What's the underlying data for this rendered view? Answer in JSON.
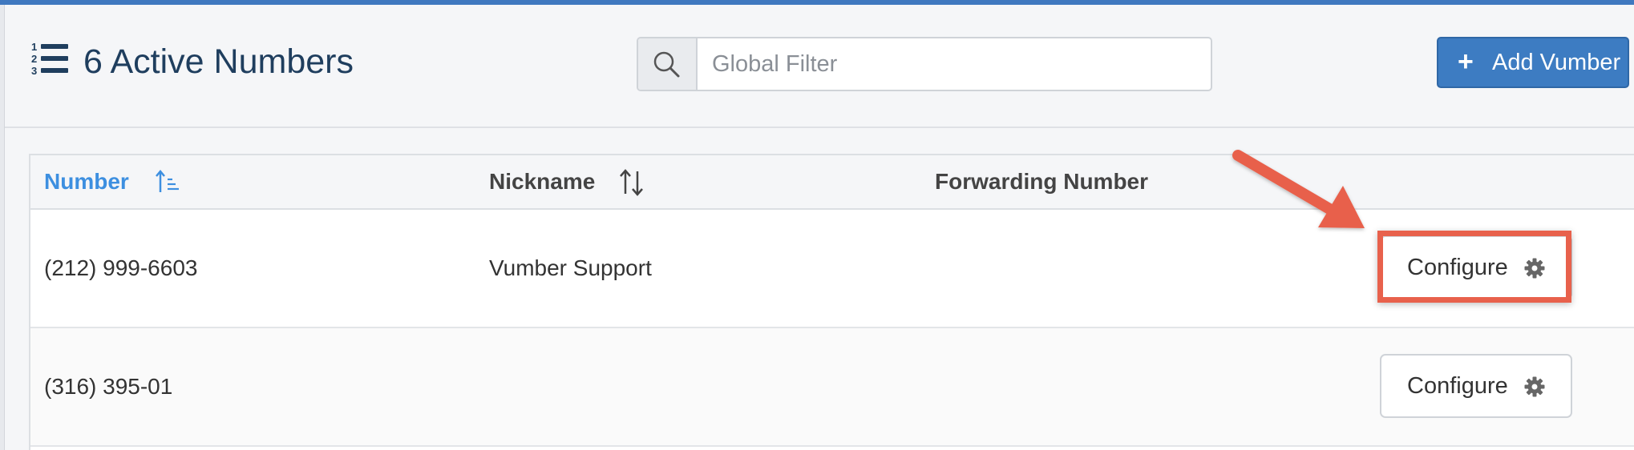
{
  "header": {
    "title": "6 Active Numbers",
    "title_icon": "ordered-list-icon",
    "search": {
      "icon": "search-icon",
      "placeholder": "Global Filter",
      "value": ""
    },
    "add_button": {
      "icon": "plus-icon",
      "plus_glyph": "+",
      "label": "Add Vumber"
    }
  },
  "table": {
    "columns": [
      {
        "label": "Number",
        "sort": "ascending",
        "active": true
      },
      {
        "label": "Nickname",
        "sort": "unsorted",
        "active": false
      },
      {
        "label": "Forwarding Number",
        "sort": "none",
        "active": false
      }
    ],
    "rows": [
      {
        "number": "(212) 999-6603",
        "nickname": "Vumber Support",
        "forwarding": "",
        "action_label": "Configure",
        "action_icon": "gear-icon",
        "highlighted": true
      },
      {
        "number": "(316) 395-01",
        "nickname": "",
        "forwarding": "",
        "action_label": "Configure",
        "action_icon": "gear-icon",
        "highlighted": false
      }
    ]
  },
  "annotation": {
    "type": "arrow-and-box",
    "color": "#e8614c",
    "target": "first-row-configure-button"
  },
  "colors": {
    "top_bar": "#3f78bf",
    "title_text": "#1f3e5e",
    "primary_button": "#3d7cc2",
    "active_column": "#3d8fe0",
    "annotation": "#e8614c"
  }
}
